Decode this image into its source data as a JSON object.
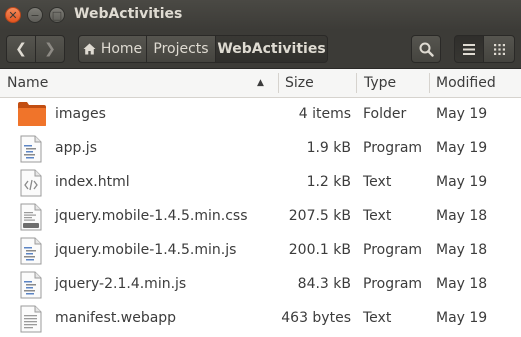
{
  "window": {
    "title": "WebActivities",
    "close_glyph": "✕",
    "minimize_glyph": "−",
    "maximize_glyph": "□"
  },
  "toolbar": {
    "back_glyph": "❮",
    "forward_glyph": "❯",
    "breadcrumbs": [
      "Home",
      "Projects",
      "WebActivities"
    ]
  },
  "columns": {
    "name": "Name",
    "size": "Size",
    "type": "Type",
    "modified": "Modified",
    "sort_glyph": "▲"
  },
  "files": [
    {
      "name": "images",
      "size": "4 items",
      "type": "Folder",
      "modified": "May 19",
      "icon": "folder-icon"
    },
    {
      "name": "app.js",
      "size": "1.9 kB",
      "type": "Program",
      "modified": "May 19",
      "icon": "script-file-icon"
    },
    {
      "name": "index.html",
      "size": "1.2 kB",
      "type": "Text",
      "modified": "May 19",
      "icon": "html-file-icon"
    },
    {
      "name": "jquery.mobile-1.4.5.min.css",
      "size": "207.5 kB",
      "type": "Text",
      "modified": "May 18",
      "icon": "css-file-icon"
    },
    {
      "name": "jquery.mobile-1.4.5.min.js",
      "size": "200.1 kB",
      "type": "Program",
      "modified": "May 18",
      "icon": "script-file-icon"
    },
    {
      "name": "jquery-2.1.4.min.js",
      "size": "84.3 kB",
      "type": "Program",
      "modified": "May 18",
      "icon": "script-file-icon"
    },
    {
      "name": "manifest.webapp",
      "size": "463 bytes",
      "type": "Text",
      "modified": "May 19",
      "icon": "text-file-icon"
    }
  ],
  "colors": {
    "titlebar": "#3c3b37",
    "close_button": "#e35520",
    "folder": "#e8641d"
  }
}
